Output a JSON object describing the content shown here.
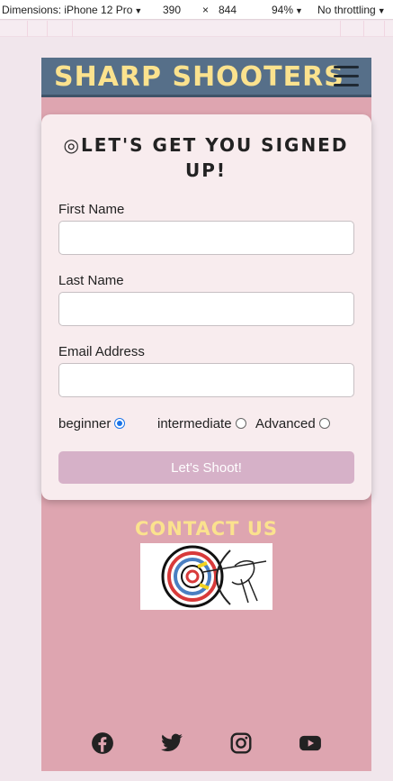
{
  "devtools": {
    "dimensions_label": "Dimensions: iPhone 12 Pro",
    "width": "390",
    "times": "×",
    "height": "844",
    "zoom": "94%",
    "throttling": "No throttling",
    "caret": "▼"
  },
  "navbar": {
    "brand": "SHARP SHOOTERS",
    "menu_icon": "hamburger-menu-icon"
  },
  "signup": {
    "title_icon": "◎",
    "title": "LET'S GET YOU SIGNED UP!",
    "first_name_label": "First Name",
    "last_name_label": "Last Name",
    "email_label": "Email Address",
    "levels": [
      {
        "label": "beginner",
        "checked": true
      },
      {
        "label": "intermediate",
        "checked": false
      },
      {
        "label": "Advanced",
        "checked": false
      }
    ],
    "submit_label": "Let's Shoot!"
  },
  "contact": {
    "heading": "CONTACT US",
    "image_icon": "archer-target-illustration"
  },
  "social": [
    "facebook-icon",
    "twitter-icon",
    "instagram-icon",
    "youtube-icon"
  ],
  "colors": {
    "navbar": "#566f89",
    "brand_text": "#fbe28e",
    "page_bg": "#dea5b0",
    "card_bg": "#f8ecee",
    "button": "#d6b1c8",
    "radio_accent": "#1a73e8"
  }
}
